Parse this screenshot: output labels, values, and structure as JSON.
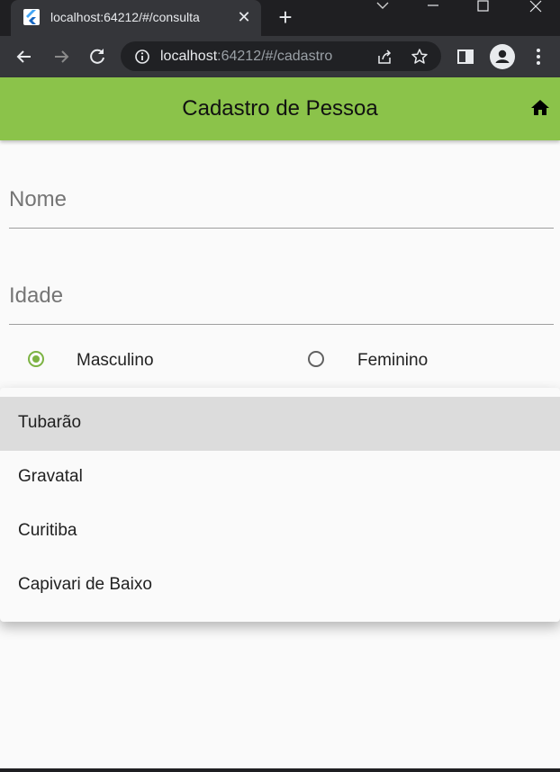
{
  "browser": {
    "tab_title": "localhost:64212/#/consulta",
    "url_host": "localhost",
    "url_path": ":64212/#/cadastro"
  },
  "app": {
    "title": "Cadastro de Pessoa",
    "accent_color": "#8bc34a"
  },
  "form": {
    "nome_placeholder": "Nome",
    "idade_placeholder": "Idade",
    "sexo": {
      "options": [
        "Masculino",
        "Feminino"
      ],
      "selected": "Masculino"
    }
  },
  "cidade_menu": {
    "items": [
      "Tubarão",
      "Gravatal",
      "Curitiba",
      "Capivari de Baixo"
    ],
    "highlighted": "Tubarão"
  }
}
